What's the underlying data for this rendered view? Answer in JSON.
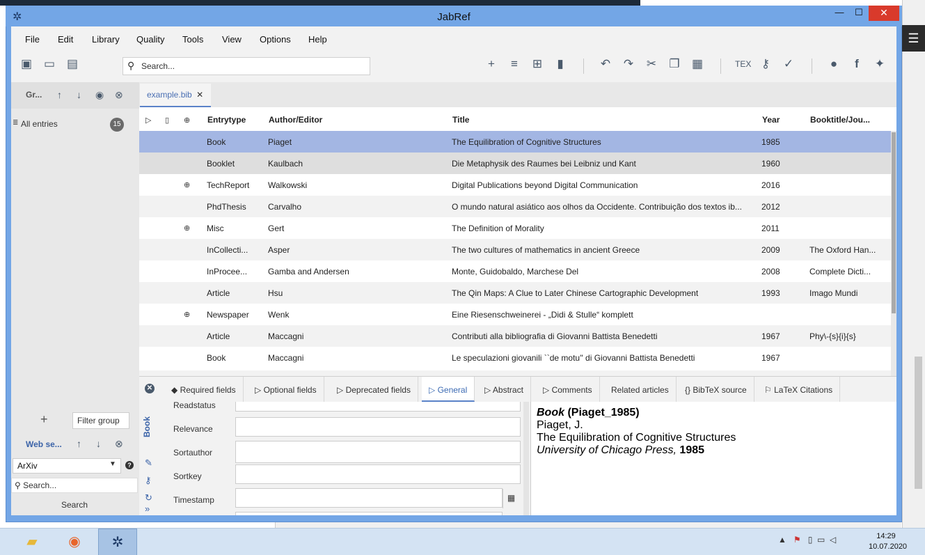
{
  "window": {
    "title": "JabRef",
    "minimize": "—",
    "maximize": "☐",
    "close": "✕"
  },
  "menu": [
    "File",
    "Edit",
    "Library",
    "Quality",
    "Tools",
    "View",
    "Options",
    "Help"
  ],
  "search": {
    "placeholder": "Search..."
  },
  "toolbar_icons": [
    "new-library-icon",
    "open-library-icon",
    "save-icon",
    "add-entry-icon",
    "add-entry-from-id-icon",
    "new-entry-icon",
    "delete-icon",
    "undo-icon",
    "redo-icon",
    "cut-icon",
    "copy-icon",
    "paste-icon",
    "tex-icon",
    "key-icon",
    "cleanup-icon",
    "github-icon",
    "facebook-icon",
    "twitter-icon"
  ],
  "groups": {
    "title": "Gr...",
    "all_entries": "All entries",
    "count": "15",
    "filter_placeholder": "Filter group",
    "add": "+"
  },
  "web_search": {
    "title": "Web se...",
    "fetcher": "ArXiv",
    "search_placeholder": "Search...",
    "search_button": "Search"
  },
  "file_tab": {
    "label": "example.bib",
    "close": "✕"
  },
  "table": {
    "columns": [
      "Entrytype",
      "Author/Editor",
      "Title",
      "Year",
      "Booktitle/Jou..."
    ],
    "rows": [
      {
        "type": "Book",
        "author": "Piaget",
        "title": "The Equilibration of Cognitive Structures",
        "year": "1985",
        "booktitle": "",
        "url": false,
        "state": "selected"
      },
      {
        "type": "Booklet",
        "author": "Kaulbach",
        "title": "Die Metaphysik des Raumes bei Leibniz und Kant",
        "year": "1960",
        "booktitle": "",
        "url": false,
        "state": "hover"
      },
      {
        "type": "TechReport",
        "author": "Walkowski",
        "title": "Digital Publications beyond Digital Communication",
        "year": "2016",
        "booktitle": "",
        "url": true,
        "state": "normal"
      },
      {
        "type": "PhdThesis",
        "author": "Carvalho",
        "title": "O mundo natural asiático aos olhos da Occidente. Contribuição dos textos ib...",
        "year": "2012",
        "booktitle": "",
        "url": false,
        "state": "alt"
      },
      {
        "type": "Misc",
        "author": "Gert",
        "title": "The Definition of Morality",
        "year": "2011",
        "booktitle": "",
        "url": true,
        "state": "normal"
      },
      {
        "type": "InCollecti...",
        "author": "Asper",
        "title": "The two cultures of mathematics in ancient Greece",
        "year": "2009",
        "booktitle": "The Oxford Han...",
        "url": false,
        "state": "alt"
      },
      {
        "type": "InProcee...",
        "author": "Gamba and Andersen",
        "title": "Monte, Guidobaldo, Marchese Del",
        "year": "2008",
        "booktitle": "Complete Dicti...",
        "url": false,
        "state": "normal"
      },
      {
        "type": "Article",
        "author": "Hsu",
        "title": "The Qin Maps: A Clue to Later Chinese Cartographic Development",
        "year": "1993",
        "booktitle": "Imago Mundi",
        "url": false,
        "state": "alt"
      },
      {
        "type": "Newspaper",
        "author": "Wenk",
        "title": "Eine Riesenschweinerei - „Didi & Stulle“ komplett",
        "year": "",
        "booktitle": "",
        "url": true,
        "state": "normal"
      },
      {
        "type": "Article",
        "author": "Maccagni",
        "title": "Contributi alla bibliografia di Giovanni Battista Benedetti",
        "year": "1967",
        "booktitle": "Phy\\-{s}{i}{s}",
        "url": false,
        "state": "alt"
      },
      {
        "type": "Book",
        "author": "Maccagni",
        "title": "Le speculazioni giovanili ``de motu'' di Giovanni Battista Benedetti",
        "year": "1967",
        "booktitle": "",
        "url": false,
        "state": "normal"
      }
    ]
  },
  "editor": {
    "entry_type": "Book",
    "tabs": [
      "Required fields",
      "Optional fields",
      "Deprecated fields",
      "General",
      "Abstract",
      "Comments",
      "Related articles",
      "{} BibTeX source",
      "LaTeX Citations"
    ],
    "active_tab": "General",
    "fields": [
      "Readstatus",
      "Relevance",
      "Sortauthor",
      "Sortkey",
      "Timestamp"
    ]
  },
  "preview": {
    "type": "Book",
    "key": "(Piaget_1985)",
    "author": "Piaget, J.",
    "title": "The Equilibration of Cognitive Structures",
    "publisher": "University of Chicago Press,",
    "year": "1985"
  },
  "taskbar": {
    "time": "14:29",
    "date": "10.07.2020"
  },
  "colors": {
    "titlebar": "#73a6e6",
    "selected_row": "#a3b6e3",
    "accent": "#3b6ab3",
    "close": "#d93a2b"
  }
}
